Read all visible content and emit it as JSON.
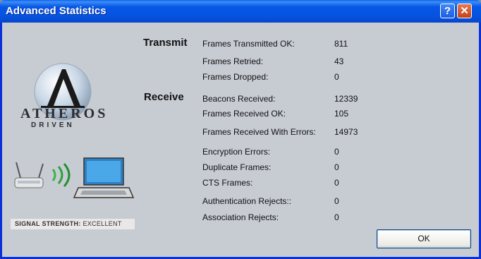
{
  "window": {
    "title": "Advanced Statistics",
    "help_label": "?",
    "close_label": "✕"
  },
  "logo": {
    "brand_line1": "ATHEROS",
    "brand_line2": "DRIVEN"
  },
  "signal": {
    "label": "SIGNAL STRENGTH:",
    "value": "EXCELLENT"
  },
  "transmit": {
    "heading": "Transmit",
    "stats": [
      {
        "label": "Frames Transmitted OK:",
        "value": "811"
      },
      {
        "label": "Frames Retried:",
        "value": "43"
      },
      {
        "label": "Frames Dropped:",
        "value": "0"
      }
    ]
  },
  "receive": {
    "heading": "Receive",
    "stats": [
      {
        "label": "Beacons Received:",
        "value": "12339"
      },
      {
        "label": "Frames Received OK:",
        "value": "105"
      },
      {
        "label": "Frames Received With Errors:",
        "value": "14973"
      },
      {
        "label": "Encryption Errors:",
        "value": "0"
      },
      {
        "label": "Duplicate Frames:",
        "value": "0"
      },
      {
        "label": "CTS Frames:",
        "value": "0"
      },
      {
        "label": "Authentication Rejects::",
        "value": "0"
      },
      {
        "label": "Association Rejects:",
        "value": "0"
      }
    ]
  },
  "buttons": {
    "ok_label": "OK"
  },
  "colors": {
    "titlebar": "#0553e0",
    "client_background": "#c7ccd3",
    "close_button": "#c4401c"
  }
}
